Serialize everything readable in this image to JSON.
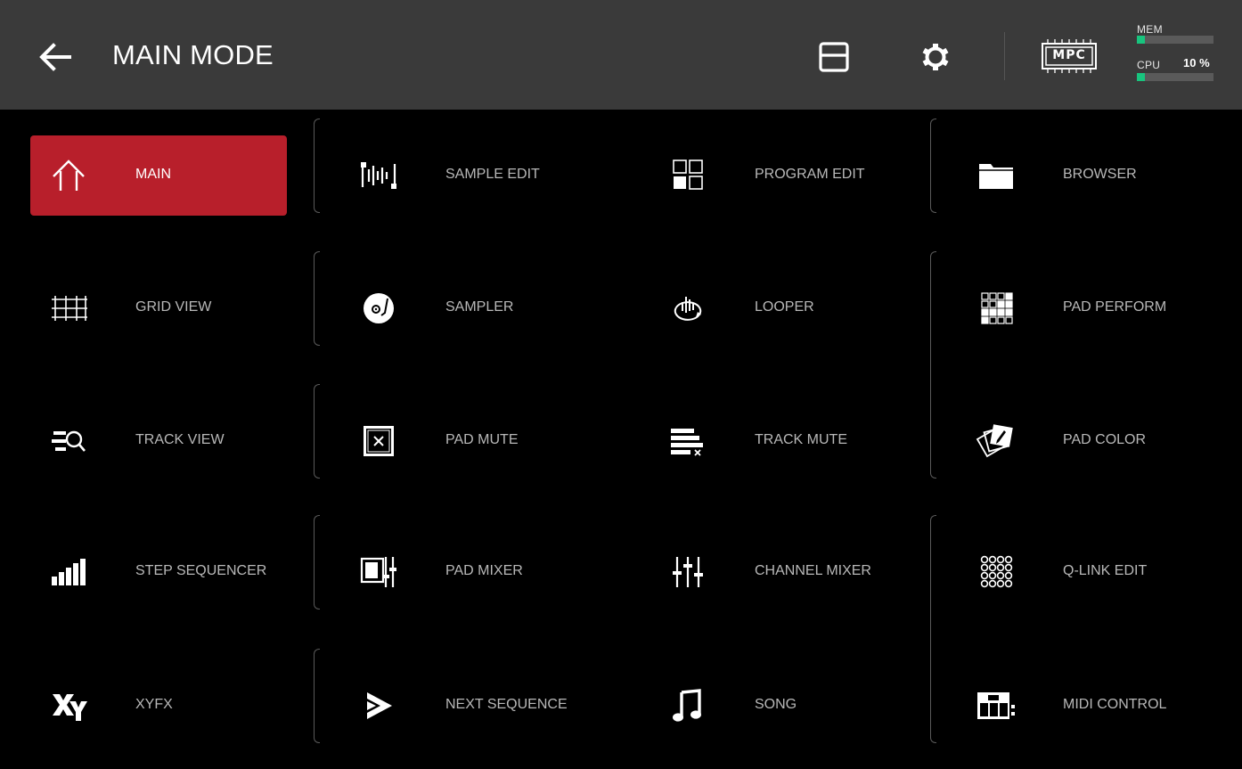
{
  "header": {
    "title": "MAIN MODE",
    "chip_label": "MPC",
    "mem_label": "MEM",
    "mem_fraction": 0.1,
    "cpu_label": "CPU",
    "cpu_value": "10 %",
    "cpu_fraction": 0.1,
    "meter_color": "#18c47e",
    "background": "#3a3a3a"
  },
  "accent_color": "#b81f2b",
  "modes": [
    {
      "label": "MAIN",
      "icon": "home-icon",
      "active": true
    },
    {
      "label": "SAMPLE EDIT",
      "icon": "waveform-icon"
    },
    {
      "label": "PROGRAM EDIT",
      "icon": "program-grid-icon"
    },
    {
      "label": "BROWSER",
      "icon": "folder-icon"
    },
    {
      "label": "GRID VIEW",
      "icon": "grid-icon"
    },
    {
      "label": "SAMPLER",
      "icon": "turntable-icon"
    },
    {
      "label": "LOOPER",
      "icon": "looper-icon"
    },
    {
      "label": "PAD PERFORM",
      "icon": "pad-perform-icon"
    },
    {
      "label": "TRACK VIEW",
      "icon": "track-search-icon"
    },
    {
      "label": "PAD MUTE",
      "icon": "pad-mute-icon"
    },
    {
      "label": "TRACK MUTE",
      "icon": "track-mute-icon"
    },
    {
      "label": "PAD COLOR",
      "icon": "pad-color-icon"
    },
    {
      "label": "STEP SEQUENCER",
      "icon": "step-bars-icon"
    },
    {
      "label": "PAD MIXER",
      "icon": "pad-mixer-icon"
    },
    {
      "label": "CHANNEL MIXER",
      "icon": "faders-icon"
    },
    {
      "label": "Q-LINK EDIT",
      "icon": "qlink-knobs-icon"
    },
    {
      "label": "XYFX",
      "icon": "xy-icon"
    },
    {
      "label": "NEXT SEQUENCE",
      "icon": "next-sequence-icon"
    },
    {
      "label": "SONG",
      "icon": "music-note-icon"
    },
    {
      "label": "MIDI CONTROL",
      "icon": "midi-control-icon"
    }
  ]
}
